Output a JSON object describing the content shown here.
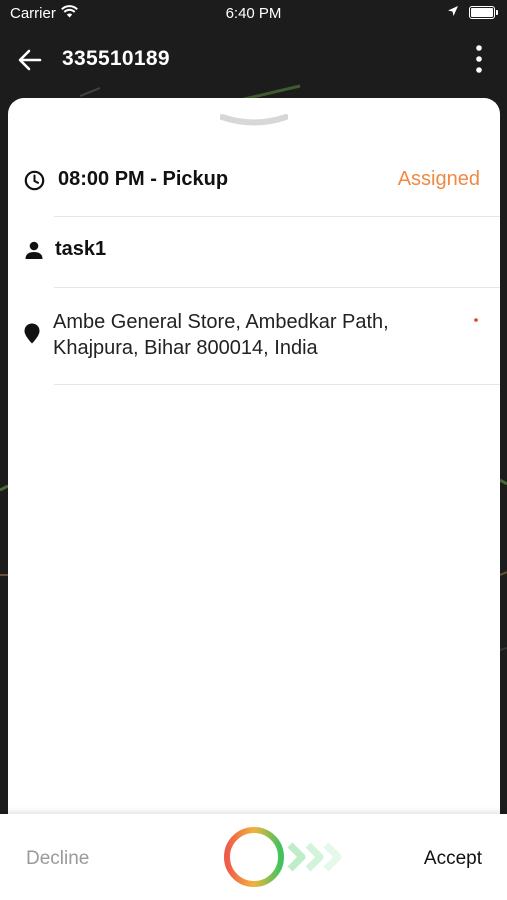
{
  "status_bar": {
    "carrier": "Carrier",
    "time": "6:40 PM"
  },
  "nav": {
    "title": "335510189"
  },
  "task": {
    "time_label": "08:00 PM - Pickup",
    "status": "Assigned",
    "name": "task1",
    "address": "Ambe General Store, Ambedkar Path, Khajpura, Bihar 800014, India"
  },
  "actions": {
    "decline_label": "Decline",
    "accept_label": "Accept"
  },
  "colors": {
    "status_accent": "#f08a43",
    "slider_ring_start": "#ef5a4a",
    "slider_ring_end": "#3fc35e"
  }
}
